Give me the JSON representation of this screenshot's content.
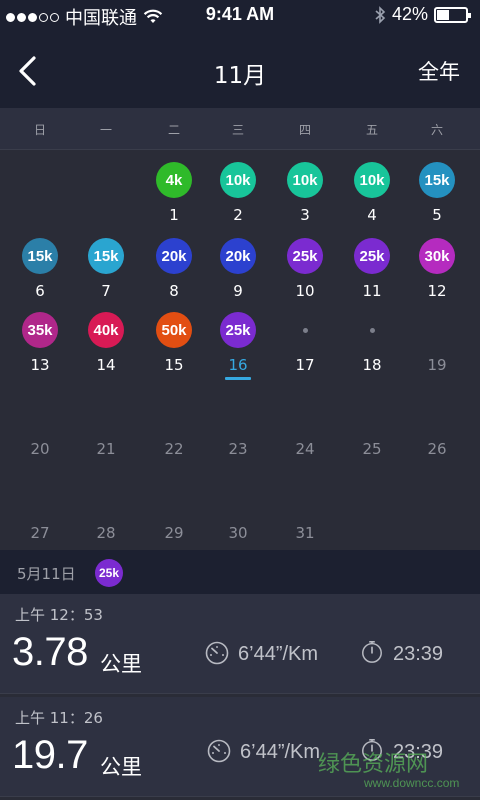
{
  "status_bar": {
    "carrier": "中国联通",
    "time": "9:41 AM",
    "battery": "42%",
    "battery_level": 0.42
  },
  "header": {
    "title": "11月",
    "right_action": "全年",
    "back_icon": "chevron-left-icon"
  },
  "weekdays": [
    "日",
    "一",
    "二",
    "三",
    "四",
    "五",
    "六"
  ],
  "days": [
    {
      "n": "1",
      "col": 2,
      "row": 0,
      "badge": "4k",
      "color": "#2fba2a"
    },
    {
      "n": "2",
      "col": 3,
      "row": 0,
      "badge": "10k",
      "color": "#18c59a"
    },
    {
      "n": "3",
      "col": 4,
      "row": 0,
      "badge": "10k",
      "color": "#18c59a"
    },
    {
      "n": "4",
      "col": 5,
      "row": 0,
      "badge": "10k",
      "color": "#18c59a"
    },
    {
      "n": "5",
      "col": 6,
      "row": 0,
      "badge": "15k",
      "color": "#2491c0"
    },
    {
      "n": "6",
      "col": 0,
      "row": 1,
      "badge": "15k",
      "color": "#2b7fa8"
    },
    {
      "n": "7",
      "col": 1,
      "row": 1,
      "badge": "15k",
      "color": "#2aa5d0"
    },
    {
      "n": "8",
      "col": 2,
      "row": 1,
      "badge": "20k",
      "color": "#2c41cf"
    },
    {
      "n": "9",
      "col": 3,
      "row": 1,
      "badge": "20k",
      "color": "#2c41cf"
    },
    {
      "n": "10",
      "col": 4,
      "row": 1,
      "badge": "25k",
      "color": "#7b2bd0"
    },
    {
      "n": "11",
      "col": 5,
      "row": 1,
      "badge": "25k",
      "color": "#7b2bd0"
    },
    {
      "n": "12",
      "col": 6,
      "row": 1,
      "badge": "30k",
      "color": "#b52bbf"
    },
    {
      "n": "13",
      "col": 0,
      "row": 2,
      "badge": "35k",
      "color": "#b0278a"
    },
    {
      "n": "14",
      "col": 1,
      "row": 2,
      "badge": "40k",
      "color": "#d81a55"
    },
    {
      "n": "15",
      "col": 2,
      "row": 2,
      "badge": "50k",
      "color": "#e24e12"
    },
    {
      "n": "16",
      "col": 3,
      "row": 2,
      "badge": "25k",
      "color": "#7b2bd0",
      "today": true
    },
    {
      "n": "17",
      "col": 4,
      "row": 2,
      "dot": true
    },
    {
      "n": "18",
      "col": 5,
      "row": 2,
      "dot": true
    },
    {
      "n": "19",
      "col": 6,
      "row": 2,
      "dim": true
    },
    {
      "n": "20",
      "col": 0,
      "row": 3,
      "dim": true
    },
    {
      "n": "21",
      "col": 1,
      "row": 3,
      "dim": true
    },
    {
      "n": "22",
      "col": 2,
      "row": 3,
      "dim": true
    },
    {
      "n": "23",
      "col": 3,
      "row": 3,
      "dim": true
    },
    {
      "n": "24",
      "col": 4,
      "row": 3,
      "dim": true
    },
    {
      "n": "25",
      "col": 5,
      "row": 3,
      "dim": true
    },
    {
      "n": "26",
      "col": 6,
      "row": 3,
      "dim": true
    },
    {
      "n": "27",
      "col": 0,
      "row": 4,
      "dim": true
    },
    {
      "n": "28",
      "col": 1,
      "row": 4,
      "dim": true
    },
    {
      "n": "29",
      "col": 2,
      "row": 4,
      "dim": true
    },
    {
      "n": "30",
      "col": 3,
      "row": 4,
      "dim": true
    },
    {
      "n": "31",
      "col": 4,
      "row": 4,
      "dim": true
    }
  ],
  "selected": {
    "date": "5月11日",
    "badge": "25k",
    "badge_color": "#7b2bd0"
  },
  "runs": [
    {
      "time": "上午 12：53",
      "distance": "3.78",
      "unit": "公里",
      "pace": "6’44”/Km",
      "duration": "23:39"
    },
    {
      "time": "上午 11：26",
      "distance": "19.7",
      "unit": "公里",
      "pace": "6’44”/Km",
      "duration": "23:39"
    }
  ],
  "watermark": {
    "text": "绿色资源网",
    "url": "www.downcc.com"
  }
}
